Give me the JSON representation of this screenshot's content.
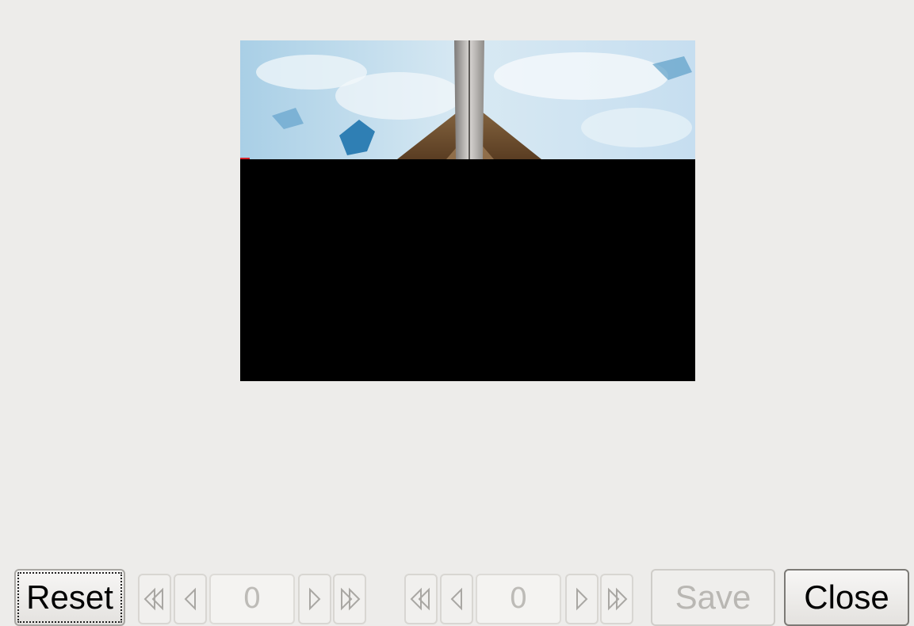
{
  "preview": {
    "sky_color": "#b9d9ee",
    "background_color": "#000000"
  },
  "buttons": {
    "reset_label": "Reset",
    "save_label": "Save",
    "close_label": "Close"
  },
  "pager1": {
    "value": "0"
  },
  "pager2": {
    "value": "0"
  },
  "icons": {
    "first": "first-page-icon",
    "prev": "previous-page-icon",
    "next": "next-page-icon",
    "last": "last-page-icon"
  }
}
